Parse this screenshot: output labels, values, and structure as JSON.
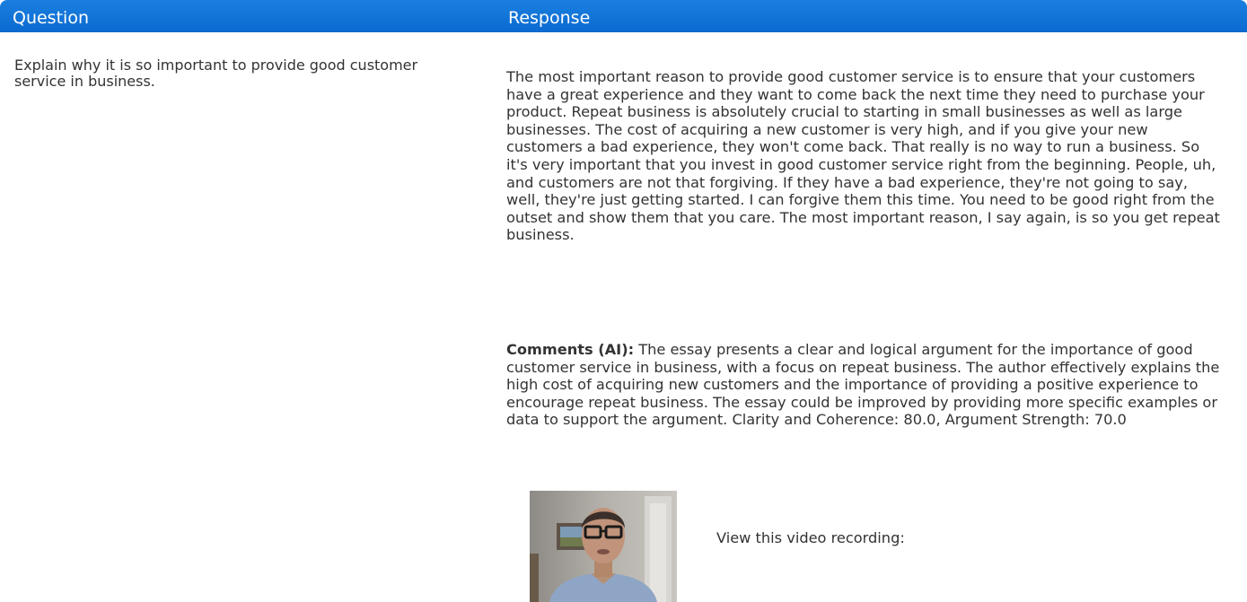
{
  "header": {
    "question_label": "Question",
    "response_label": "Response"
  },
  "question": {
    "text": "Explain why it is so important to provide good customer service in business."
  },
  "response": {
    "text": "The most important reason to provide good customer service is to ensure that your customers have a great experience and they want to come back the next time they need to purchase your product. Repeat business is absolutely crucial to starting in small businesses as well as large businesses. The cost of acquiring a new customer is very high, and if you give your new customers a bad experience, they won't come back. That really is no way to run a business. So it's very important that you invest in good customer service right from the beginning. People, uh, and customers are not that forgiving. If they have a bad experience, they're not going to say, well, they're just getting started. I can forgive them this time. You need to be good right from the outset and show them that you care. The most important reason, I say again, is so you get repeat business."
  },
  "comments": {
    "label": "Comments (AI):",
    "text": " The essay presents a clear and logical argument for the importance of good customer service in business, with a focus on repeat business. The author effectively explains the high cost of acquiring new customers and the importance of providing a positive experience to encourage repeat business. The essay could be improved by providing more specific examples or data to support the argument. Clarity and Coherence: 80.0, Argument Strength: 70.0"
  },
  "video": {
    "label": "View this video recording:"
  },
  "colors": {
    "header_bg": "#0b6ad0",
    "header_text": "#ffffff",
    "body_text": "#333333"
  }
}
